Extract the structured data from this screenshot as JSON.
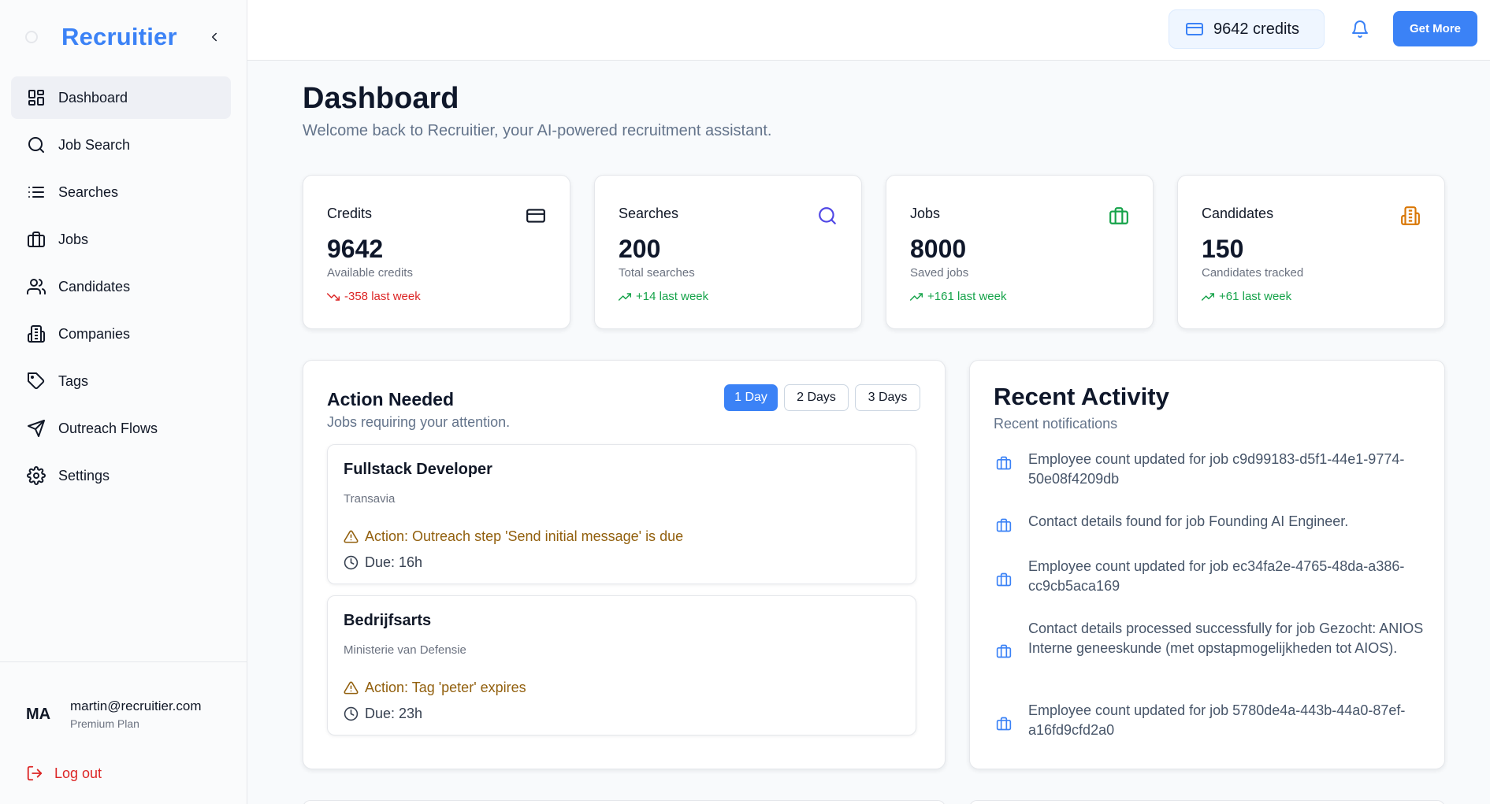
{
  "app": {
    "name": "Recruitier"
  },
  "sidebar": {
    "items": [
      {
        "label": "Dashboard",
        "icon": "dashboard-icon",
        "active": true
      },
      {
        "label": "Job Search",
        "icon": "search-icon"
      },
      {
        "label": "Searches",
        "icon": "list-icon"
      },
      {
        "label": "Jobs",
        "icon": "briefcase-icon"
      },
      {
        "label": "Candidates",
        "icon": "users-icon"
      },
      {
        "label": "Companies",
        "icon": "building-icon"
      },
      {
        "label": "Tags",
        "icon": "tag-icon"
      },
      {
        "label": "Outreach Flows",
        "icon": "send-icon"
      },
      {
        "label": "Settings",
        "icon": "gear-icon"
      }
    ],
    "user": {
      "initials": "MA",
      "email": "martin@recruitier.com",
      "plan": "Premium Plan"
    },
    "logout_label": "Log out"
  },
  "topbar": {
    "credits": "9642 credits",
    "get_more_label": "Get More"
  },
  "page": {
    "title": "Dashboard",
    "subtitle": "Welcome back to Recruitier, your AI-powered recruitment assistant."
  },
  "stats": [
    {
      "label": "Credits",
      "value": "9642",
      "desc": "Available credits",
      "delta": "-358 last week",
      "trend": "down",
      "icon": "credit-card-icon",
      "color": "#111827"
    },
    {
      "label": "Searches",
      "value": "200",
      "desc": "Total searches",
      "delta": "+14 last week",
      "trend": "up",
      "icon": "search-icon",
      "color": "#4f46e5"
    },
    {
      "label": "Jobs",
      "value": "8000",
      "desc": "Saved jobs",
      "delta": "+161 last week",
      "trend": "up",
      "icon": "briefcase-icon",
      "color": "#16a34a"
    },
    {
      "label": "Candidates",
      "value": "150",
      "desc": "Candidates tracked",
      "delta": "+61 last week",
      "trend": "up",
      "icon": "building-icon",
      "color": "#d97706"
    }
  ],
  "action_needed": {
    "title": "Action Needed",
    "subtitle": "Jobs requiring your attention.",
    "ranges": [
      "1 Day",
      "2 Days",
      "3 Days"
    ],
    "active_range": "1 Day",
    "jobs": [
      {
        "title": "Fullstack Developer",
        "company": "Transavia",
        "action": "Action: Outreach step 'Send initial message' is due",
        "due": "Due: 16h"
      },
      {
        "title": "Bedrijfsarts",
        "company": "Ministerie van Defensie",
        "action": "Action: Tag 'peter' expires",
        "due": "Due: 23h"
      }
    ]
  },
  "recent_activity": {
    "title": "Recent Activity",
    "subtitle": "Recent notifications",
    "items": [
      "Employee count updated for job c9d99183-d5f1-44e1-9774-50e08f4209db",
      "Contact details found for job Founding AI Engineer.",
      "Employee count updated for job ec34fa2e-4765-48da-a386-cc9cb5aca169",
      "Contact details processed successfully for job Gezocht: ANIOS Interne geneeskunde (met opstapmogelijkheden tot AIOS).",
      "Employee count updated for job 5780de4a-443b-44a0-87ef-a16fd9cfd2a0"
    ]
  },
  "colors": {
    "accent": "#3b82f6",
    "danger": "#dc2626",
    "success": "#16a34a",
    "warning": "#92600e"
  }
}
